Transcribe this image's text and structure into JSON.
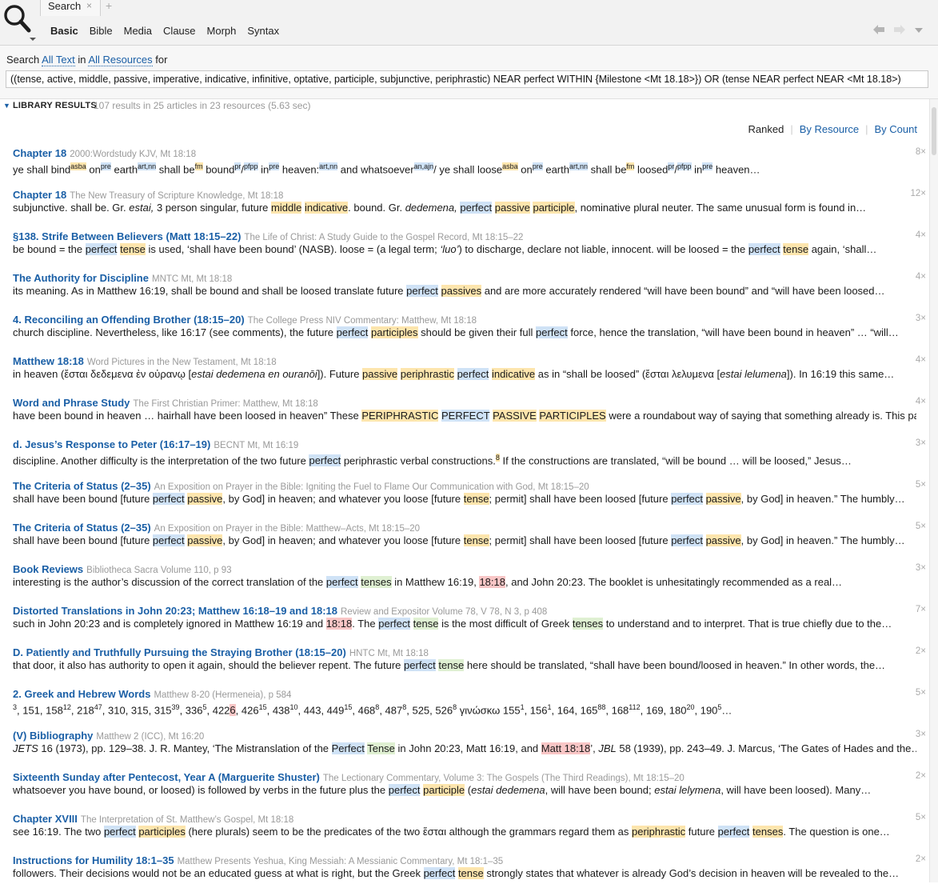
{
  "colors": {
    "link": "#1a5fa6",
    "hl_blue": "#cfe2f6",
    "hl_yellow": "#fde5ad",
    "hl_red": "#f9c6c6",
    "hl_green": "#dff0d2"
  },
  "icons": {
    "search": "search-icon",
    "close": "close-icon",
    "new_tab": "plus-icon",
    "back": "back-arrow-icon",
    "forward": "forward-arrow-icon",
    "menu": "chevron-down-icon",
    "collapse": "triangle-down-icon"
  },
  "panel": {
    "tab_label": "Search",
    "close_glyph": "×",
    "new_tab_glyph": "+"
  },
  "subtabs": [
    "Basic",
    "Bible",
    "Media",
    "Clause",
    "Morph",
    "Syntax"
  ],
  "scope": {
    "prefix": "Search",
    "what": "All Text",
    "in_word": "in",
    "resources": "All Resources",
    "suffix": "for"
  },
  "query": "((tense, active, middle, passive, imperative, indicative, infinitive, optative, participle, subjunctive, periphrastic) NEAR perfect WITHIN {Milestone <Mt 18.18>}) OR (tense NEAR perfect NEAR <Mt 18.18>)",
  "results_header": {
    "label": "LIBRARY RESULTS",
    "summary": "107 results in 25 articles in 23 resources (5.63 sec)"
  },
  "sort": {
    "selected": "Ranked",
    "options": [
      "By Resource",
      "By Count"
    ]
  },
  "results": [
    {
      "title": "Chapter 18",
      "source": "2000:Wordstudy KJV, Mt 18:18",
      "count": "8×",
      "snippet": "ye shall bind[y:asba] on[b:pre] earth[b:art,nn] shall be[y:fm] bound[b:pr]/[b:pfpp] in[b:pre] heaven:[b:art,nn] and whatsoever[b:an,ajn]/ ye shall loose[y:asba] on[b:pre] earth[b:art,nn] shall be[y:fm] loosed[b:pr]/[b:pfpp] in[b:pre] heaven…"
    },
    {
      "title": "Chapter 18",
      "source": "The New Treasury of Scripture Knowledge, Mt 18:18",
      "count": "12×",
      "snippet": "subjunctive. shall be. Gr. {estai,} 3 person singular, future [y:middle] [y:indicative]. bound. Gr. {dedemena,} [b:perfect] [y:passive] [y:participle], nominative plural neuter. The same unusual form is found in…"
    },
    {
      "title": "§138. Strife Between Believers (Matt 18:15–22)",
      "source": "The Life of Christ: A Study Guide to the Gospel Record, Mt 18:15–22",
      "count": "4×",
      "snippet": "be bound = the [b:perfect] [y:tense] is used, ‘shall have been bound’ (NASB). loose = (a legal term; {‘luo’}) to discharge, declare not liable, innocent. will be loosed = the [b:perfect] [y:tense] again, ‘shall…"
    },
    {
      "title": "The Authority for Discipline",
      "source": "MNTC Mt, Mt 18:18",
      "count": "4×",
      "snippet": "its meaning. As in Matthew 16:19, shall be bound and shall be loosed translate future [b:perfect] [y:passives] and are more accurately rendered “will have been bound” and “will have been loosed…"
    },
    {
      "title": "4. Reconciling an Offending Brother (18:15–20)",
      "source": "The College Press NIV Commentary: Matthew, Mt 18:18",
      "count": "3×",
      "snippet": "church discipline. Nevertheless, like 16:17 (see comments), the future [b:perfect] [y:participles] should be given their full [b:perfect] force, hence the translation, “will have been bound in heaven” … “will…"
    },
    {
      "title": "Matthew 18:18",
      "source": "Word Pictures in the New Testament, Mt 18:18",
      "count": "4×",
      "snippet": "in heaven (ἔσται δεδεμενα ἐν οὐρανῳ [{estai dedemena en ouranōi}]). Future [y:passive] [y:periphrastic] [b:perfect] [y:indicative] as in “shall be loosed” (ἔσται λελυμενα [{estai lelumena}]). In 16:19 this same…"
    },
    {
      "title": "Word and Phrase Study",
      "source": "The First Christian Primer: Matthew, Mt 18:18",
      "count": "4×",
      "snippet": "have been bound in heaven … hairhall have been loosed in heaven” These [y:PERIPHRASTIC] [b:PERFECT] [y:PASSIVE] [y:PARTICIPLES] were a roundabout way of saying that something already is. This passage does…"
    },
    {
      "title": "d. Jesus’s Response to Peter (16:17–19)",
      "source": "BECNT Mt, Mt 16:19",
      "count": "3×",
      "snippet": "discipline. Another difficulty is the interpretation of the two future [b:perfect] periphrastic verbal constructions.[y:8] If the constructions are translated, “will be bound … will be loosed,” Jesus…"
    },
    {
      "title": "The Criteria of Status (2–35)",
      "source": "An Exposition on Prayer in the Bible: Igniting the Fuel to Flame Our Communication with God, Mt 18:15–20",
      "count": "5×",
      "snippet": "shall have been bound [future [b:perfect] [y:passive], by God] in heaven; and whatever you loose [future [y:tense]; permit] shall have been loosed [future [b:perfect] [y:passive], by God] in heaven.” The humbly…"
    },
    {
      "title": "The Criteria of Status (2–35)",
      "source": "An Exposition on Prayer in the Bible: Matthew–Acts, Mt 18:15–20",
      "count": "5×",
      "snippet": "shall have been bound [future [b:perfect] [y:passive], by God] in heaven; and whatever you loose [future [y:tense]; permit] shall have been loosed [future [b:perfect] [y:passive], by God] in heaven.” The humbly…"
    },
    {
      "title": "Book Reviews",
      "source": "Bibliotheca Sacra Volume 110, p 93",
      "count": "3×",
      "snippet": "interesting is the author’s discussion of the correct translation of the [b:perfect] [g:tenses] in Matthew 16:19, [r:18:18], and John 20:23. The booklet is unhesitatingly recommended as a real…"
    },
    {
      "title": "Distorted Translations in John 20:23; Matthew 16:18–19 and 18:18",
      "source": "Review and Expositor Volume 78, V 78, N 3, p 408",
      "count": "7×",
      "snippet": "such in John 20:23 and is completely ignored in Matthew 16:19 and [r:18:18]. The [b:perfect] [g:tense] is the most difficult of Greek [g:tenses] to understand and to interpret. That is true chiefly due to the…"
    },
    {
      "title": "D. Patiently and Truthfully Pursuing the Straying Brother (18:15–20)",
      "source": "HNTC Mt, Mt 18:18",
      "count": "2×",
      "snippet": "that door, it also has authority to open it again, should the believer repent. The future [b:perfect] [g:tense] here should be translated, “shall have been bound/loosed in heaven.” In other words, the…"
    },
    {
      "title": "2. Greek and Hebrew Words",
      "source": "Matthew 8-20 (Hermeneia), p 584",
      "count": "5×",
      "snippet": "^3, 151, 158^12, 218^47, 310, 315, 315^39, 336^5, 422[r:6], 426^15, 438^10, 443, 449^15, 468^8, 487^8, 525, 526^8 γινώσκω 155^1, 156^1, 164, 165^88, 168^112, 169, 180^20, 190^5…"
    },
    {
      "title": "(V) Bibliography",
      "source": "Matthew 2 (ICC), Mt 16:20",
      "count": "3×",
      "snippet": "{JETS} 16 (1973), pp. 129–38. J. R. Mantey, ‘The Mistranslation of the [b:Perfect] [g:Tense] in John 20:23, Matt 16:19, and [r:Matt 18:18]’, {JBL} 58 (1939), pp. 243–49. J. Marcus, ‘The Gates of Hades and the…"
    },
    {
      "title": "Sixteenth Sunday after Pentecost, Year A (Marguerite Shuster)",
      "source": "The Lectionary Commentary, Volume 3: The Gospels (The Third Readings), Mt 18:15–20",
      "count": "2×",
      "snippet": "whatsoever you have bound, or loosed) is followed by verbs in the future plus the [b:perfect] [y:participle] ({estai dedemena}, will have been bound; {estai lelymena}, will have been loosed). Many…"
    },
    {
      "title": "Chapter XVIII",
      "source": "The Interpretation of St. Matthew’s Gospel, Mt 18:18",
      "count": "5×",
      "snippet": "see 16:19. The two [b:perfect] [y:participles] (here plurals) seem to be the predicates of the two ἔσται although the grammars regard them as [y:periphrastic] future [b:perfect] [y:tenses]. The question is one…"
    },
    {
      "title": "Instructions for Humility 18:1–35",
      "source": "Matthew Presents Yeshua, King Messiah: A Messianic Commentary, Mt 18:1–35",
      "count": "2×",
      "snippet": "followers. Their decisions would not be an educated guess at what is right, but the Greek [b:perfect] [y:tense] strongly states that whatever is already God’s decision in heaven will be revealed to the…"
    }
  ]
}
